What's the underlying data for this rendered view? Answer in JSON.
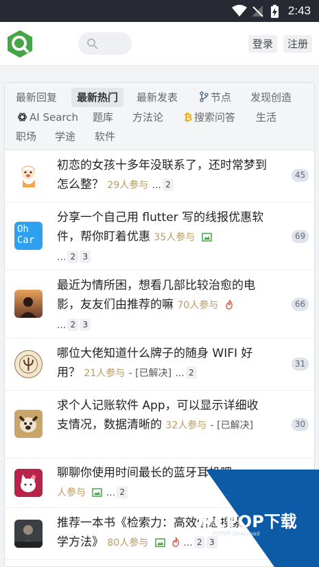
{
  "status_bar": {
    "time": "2:43"
  },
  "header": {
    "login_label": "登录",
    "register_label": "注册"
  },
  "tabs": [
    {
      "label": "最新回复"
    },
    {
      "label": "最新热门"
    },
    {
      "label": "最新发表"
    },
    {
      "label": "节点"
    },
    {
      "label": "发现创造"
    },
    {
      "label": "AI Search"
    },
    {
      "label": "题库"
    },
    {
      "label": "方法论"
    },
    {
      "label": "搜索问答"
    },
    {
      "label": "生活"
    },
    {
      "label": "职场"
    },
    {
      "label": "学途"
    },
    {
      "label": "软件"
    }
  ],
  "topics": [
    {
      "title": "初恋的女孩十多年没联系了，还时常梦到怎么整？",
      "participants": "29人参与",
      "dots": "...",
      "pages": [
        "2"
      ],
      "count": "45"
    },
    {
      "title": "分享一个自己用 flutter 写的线报优惠软件，帮你盯着优惠",
      "avatar_text": "Oh Car",
      "participants": "35人参与",
      "dots": "...",
      "pages": [
        "2",
        "3"
      ],
      "count": "69"
    },
    {
      "title": "最近为情所困，想看几部比较治愈的电影，友友们由推荐的嘛",
      "participants": "70人参与",
      "dots": "...",
      "pages": [
        "2",
        "3"
      ],
      "count": "66"
    },
    {
      "title": "哪位大佬知道什么牌子的随身 WIFI 好用？",
      "participants": "21人参与",
      "status": "- [已解决]",
      "dots": "...",
      "pages": [
        "2"
      ],
      "count": "31"
    },
    {
      "title": "求个人记账软件 App，可以显示详细收支情况，数据清晰的",
      "participants": "32人参与",
      "status": "- [已解决]",
      "count": "30"
    },
    {
      "title": "聊聊你使用时间最长的蓝牙耳机吧",
      "participants": "人参与",
      "dots": "...",
      "pages": [
        "2"
      ]
    },
    {
      "title": "推荐一本书《检索力：高效信息搜索的科学方法》",
      "participants": "80人参与",
      "dots": "...",
      "pages": [
        "2",
        "3"
      ]
    }
  ],
  "watermark": {
    "brand": "PCPOP下载",
    "sub": "PCPOP Download"
  },
  "colors": {
    "accent": "#47a447",
    "participants": "#b89a5f",
    "count_bg": "#dde4ec",
    "watermark": "#0d5aa7"
  }
}
